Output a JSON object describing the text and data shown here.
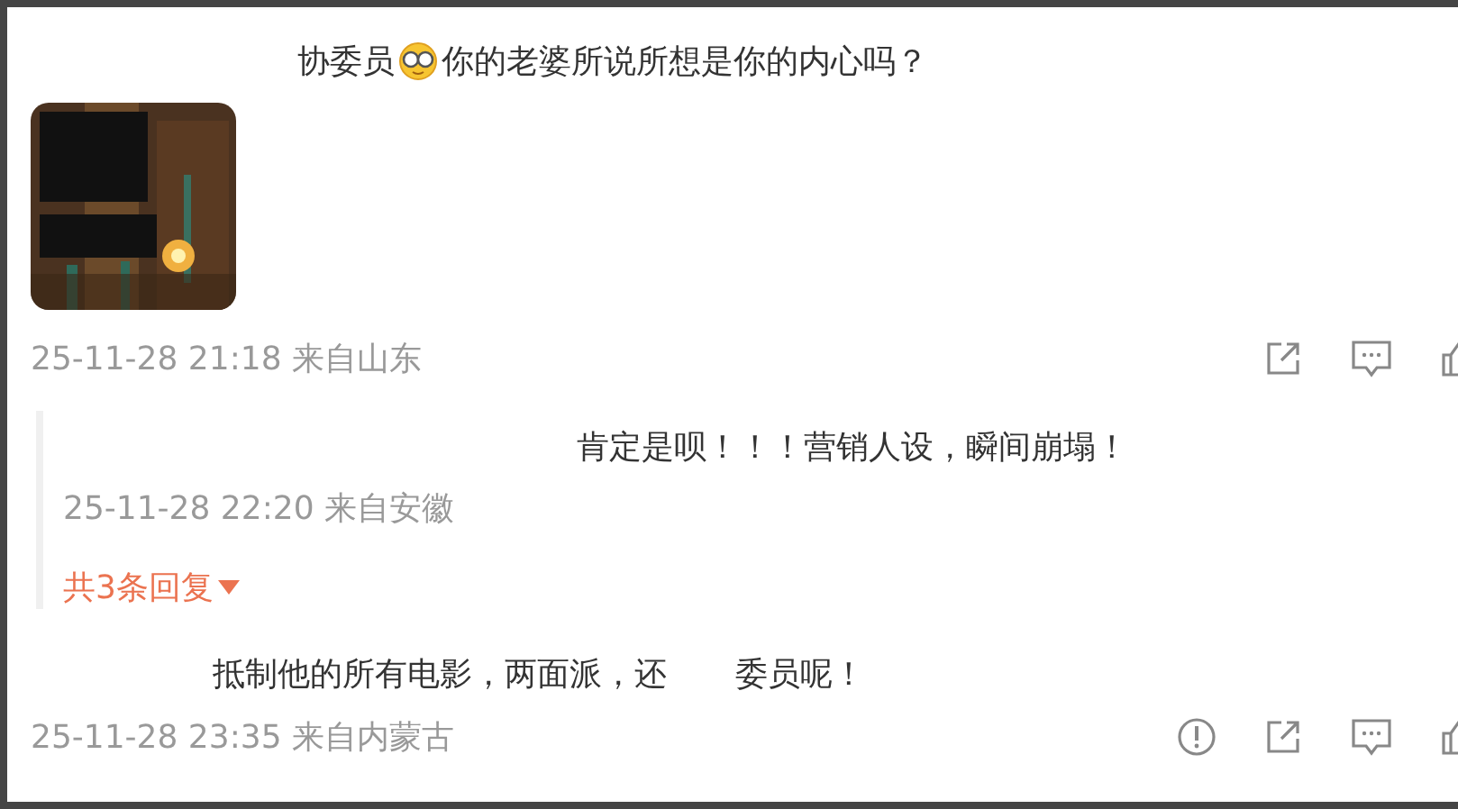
{
  "comment": {
    "segments": [
      {
        "kind": "text",
        "text": "协委员"
      },
      {
        "kind": "emoji"
      },
      {
        "kind": "text",
        "text": " 你的老婆所说所想是你的内心吗？"
      }
    ],
    "meta": "25-11-28 21:18 来自山东",
    "actions": [
      {
        "kind": "share"
      },
      {
        "kind": "comment"
      },
      {
        "kind": "like"
      }
    ]
  },
  "reply": {
    "text": "肯定是呗！！！营销人设，瞬间崩塌！",
    "meta": "25-11-28 22:20 来自安徽",
    "more": "共3条回复"
  },
  "comment_2": {
    "segments": [
      "抵制他的所有电影，两面派，还",
      "委员呢！"
    ],
    "meta": "25-11-28 23:35 来自内蒙古",
    "actions": [
      {
        "kind": "report"
      },
      {
        "kind": "share"
      },
      {
        "kind": "comment"
      },
      {
        "kind": "like"
      }
    ]
  }
}
